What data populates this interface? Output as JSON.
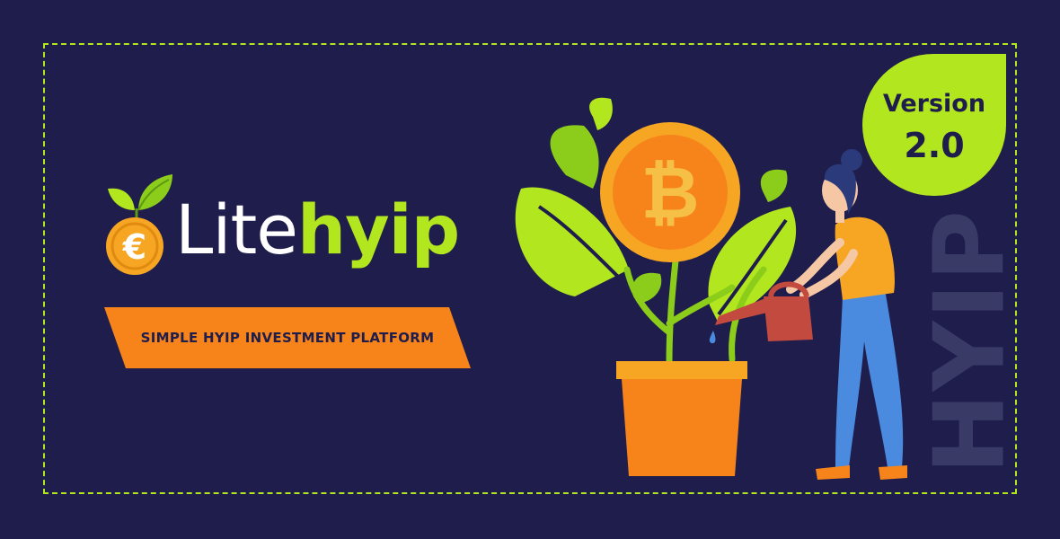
{
  "brand": {
    "name_part1": "Lite",
    "name_part2": "hyip",
    "tagline": "SIMPLE HYIP INVESTMENT PLATFORM",
    "coin_symbol": "€"
  },
  "version": {
    "label": "Version",
    "number": "2.0"
  },
  "side_word": "HYIP",
  "illustration": {
    "coin_symbol": "₿"
  },
  "colors": {
    "background": "#1f1d4c",
    "accent_green": "#b2e61e",
    "orange": "#f7841b",
    "coin_gold": "#f6a623",
    "jeans_blue": "#4a8be0",
    "watering_can": "#c24a3e"
  }
}
